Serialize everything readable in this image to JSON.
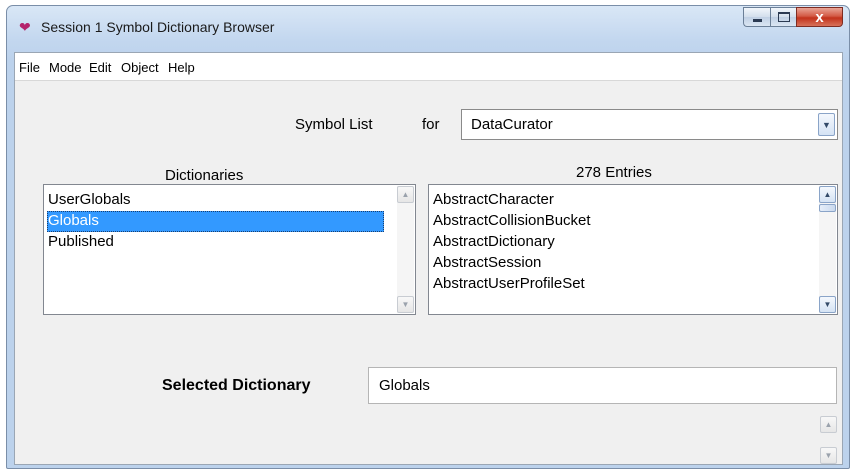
{
  "window": {
    "title": "Session 1 Symbol Dictionary Browser",
    "icon": "gem-icon",
    "controls": {
      "minimize": "minimize",
      "maximize": "maximize",
      "close": "x"
    }
  },
  "menu": [
    {
      "label": "File"
    },
    {
      "label": "Mode"
    },
    {
      "label": "Edit"
    },
    {
      "label": "Object"
    },
    {
      "label": "Help"
    }
  ],
  "symbol_list": {
    "label": "Symbol List",
    "for_label": "for",
    "selected_user": "DataCurator"
  },
  "dictionaries": {
    "header": "Dictionaries",
    "items": [
      {
        "label": "UserGlobals",
        "selected": false
      },
      {
        "label": "Globals",
        "selected": true
      },
      {
        "label": "Published",
        "selected": false
      }
    ]
  },
  "entries": {
    "header": "278 Entries",
    "items": [
      {
        "label": "AbstractCharacter"
      },
      {
        "label": "AbstractCollisionBucket"
      },
      {
        "label": "AbstractDictionary"
      },
      {
        "label": "AbstractSession"
      },
      {
        "label": "AbstractUserProfileSet"
      }
    ]
  },
  "selected_dictionary": {
    "label": "Selected Dictionary",
    "value": "Globals"
  },
  "colors": {
    "selection": "#3399ff",
    "close_button": "#c2321b",
    "title_gradient": "#c3d7ef"
  }
}
